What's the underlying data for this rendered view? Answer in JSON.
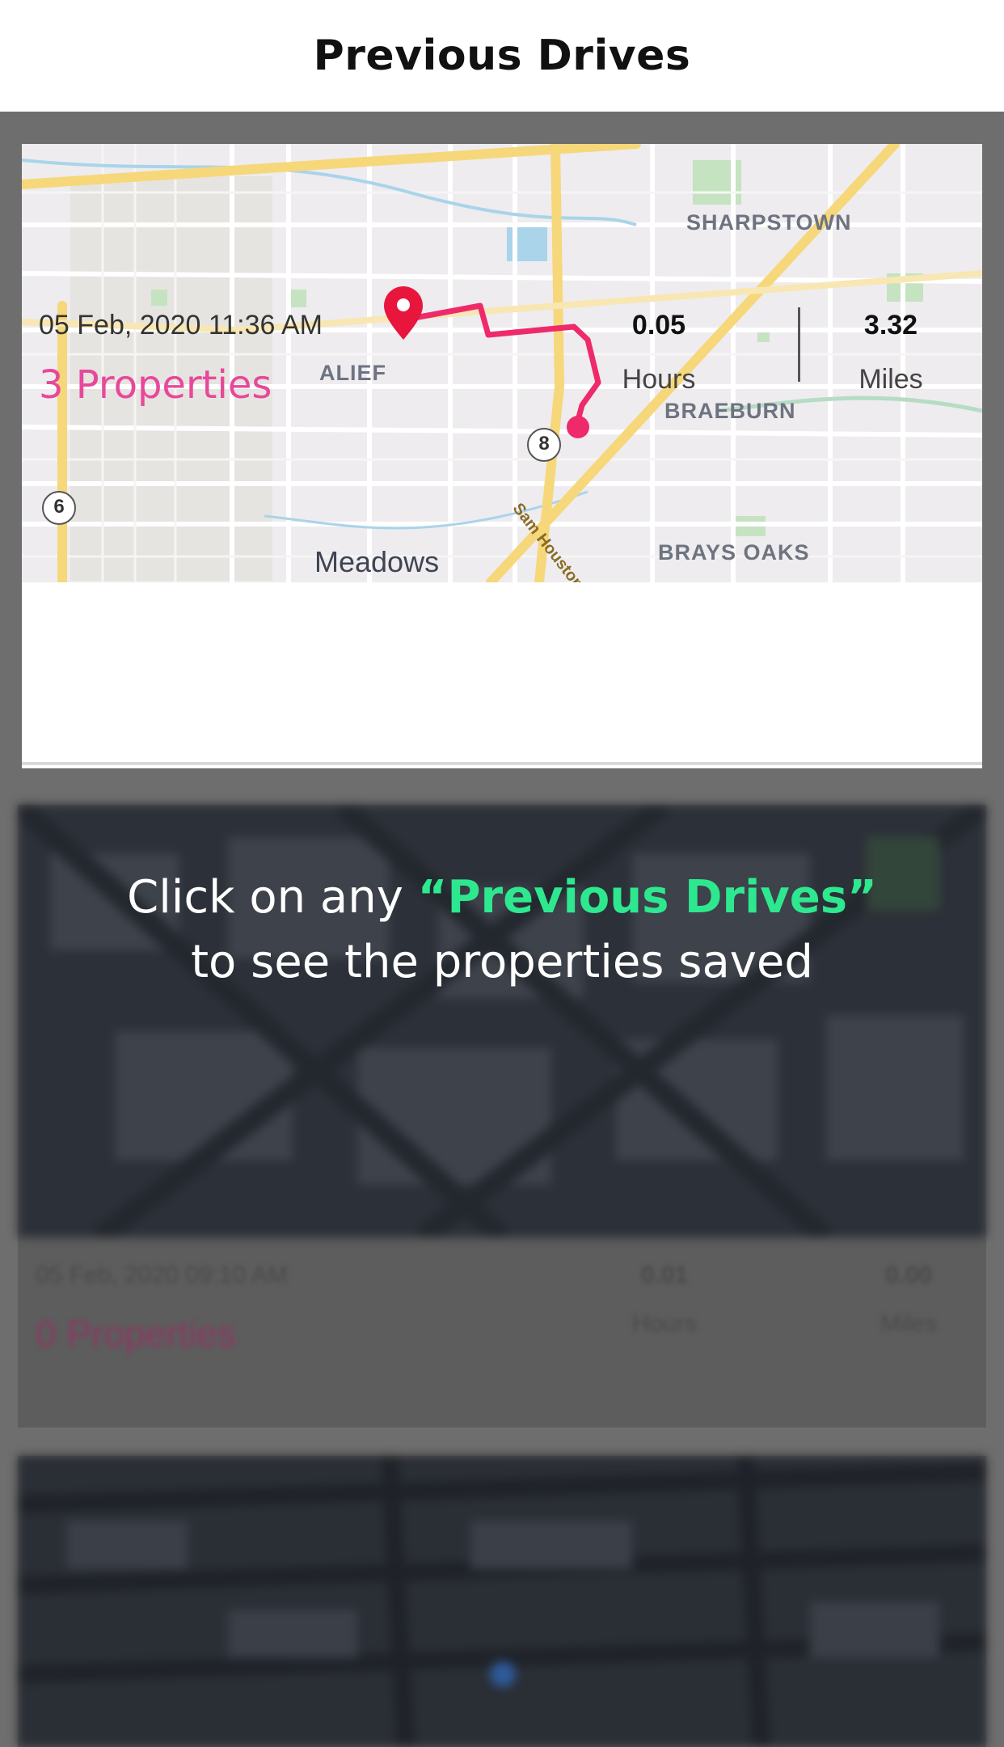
{
  "header": {
    "title": "Previous Drives"
  },
  "drive": {
    "datetime": "05 Feb, 2020 11:36 AM",
    "properties": "3 Properties",
    "hours_value": "0.05",
    "hours_label": "Hours",
    "miles_value": "3.32",
    "miles_label": "Miles"
  },
  "map": {
    "labels": {
      "sharpstown": "SHARPSTOWN",
      "alief": "ALIEF",
      "braeburn": "BRAEBURN",
      "brays_oaks": "BRAYS OAKS",
      "meadows": "Meadows",
      "highway_8": "8",
      "highway_6": "6",
      "toll_road": "Sam Houston To"
    },
    "route_color": "#ee2a6a",
    "pin_color": "#e8163c"
  },
  "hint": {
    "line1_prefix": "Click on any ",
    "line1_accent": "“Previous Drives”",
    "line2": "to see the properties saved"
  },
  "ghost_drive": {
    "datetime": "05 Feb, 2020 09:10 AM",
    "properties": "0 Properties",
    "hours_value": "0.01",
    "hours_label": "Hours",
    "miles_value": "0.00",
    "miles_label": "Miles"
  },
  "colors": {
    "accent_pink": "#e8489a",
    "hint_green": "#2ee88f"
  }
}
